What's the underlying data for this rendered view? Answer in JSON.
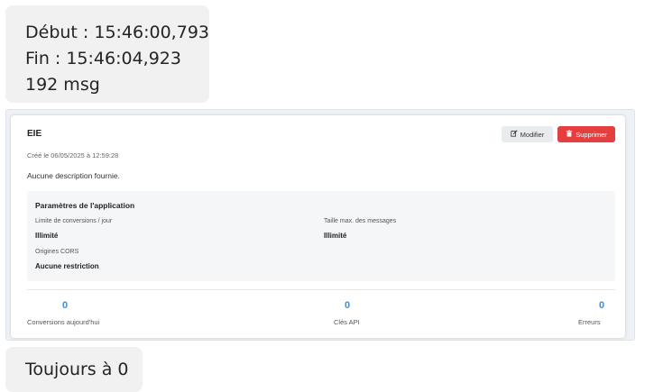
{
  "chat": {
    "top_message": {
      "line1": "Début : 15:46:00,793",
      "line2": "Fin : 15:46:04,923",
      "line3": "192 msg"
    },
    "bottom_message": "Toujours à 0"
  },
  "app_card": {
    "name": "EIE",
    "created": "Créé le 06/05/2025 à 12:59:28",
    "description": "Aucune description fournie.",
    "buttons": {
      "edit": {
        "label": "Modifier",
        "icon": "edit-icon"
      },
      "delete": {
        "label": "Supprimer",
        "icon": "trash-icon",
        "color": "#e53e3e"
      }
    },
    "params": {
      "title": "Paramètres de l'application",
      "conversion_limit": {
        "label": "Limite de conversions / jour",
        "value": "Illimité"
      },
      "max_message_size": {
        "label": "Taille max. des messages",
        "value": "Illimité"
      },
      "cors": {
        "label": "Origines CORS",
        "value": "Aucune restriction"
      }
    },
    "stats": {
      "conversions_today": {
        "value": "0",
        "label": "Conversions aujourd'hui"
      },
      "api_keys": {
        "value": "0",
        "label": "Clés API"
      },
      "errors": {
        "value": "0",
        "label": "Erreurs"
      }
    },
    "accent_color": "#3a8fd9"
  }
}
